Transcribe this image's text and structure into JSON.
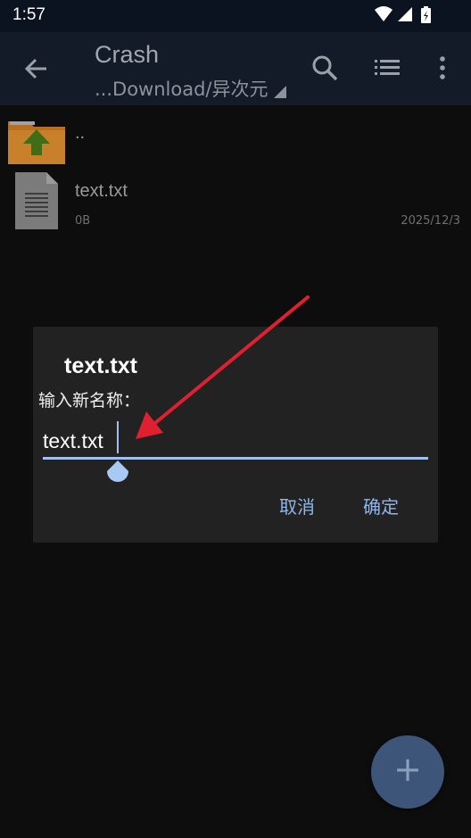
{
  "status_bar": {
    "time": "1:57",
    "icons": [
      "wifi-icon",
      "signal-icon",
      "battery-charging-icon"
    ]
  },
  "app_bar": {
    "title": "Crash",
    "subtitle": "...Download/异次元",
    "actions": [
      "search-icon",
      "list-view-icon",
      "more-vert-icon"
    ]
  },
  "files": [
    {
      "name": "..",
      "type": "parent-folder"
    },
    {
      "name": "text.txt",
      "size": "0B",
      "date": "2025/12/3",
      "type": "text-file"
    }
  ],
  "dialog": {
    "title": "text.txt",
    "prompt": "输入新名称：",
    "input_value": "text.txt",
    "cancel_label": "取消",
    "confirm_label": "确定"
  },
  "fab": {
    "label": "+"
  },
  "colors": {
    "accent": "#9ec1f0",
    "appbar": "#131b28",
    "annotation_arrow": "#e02030"
  }
}
